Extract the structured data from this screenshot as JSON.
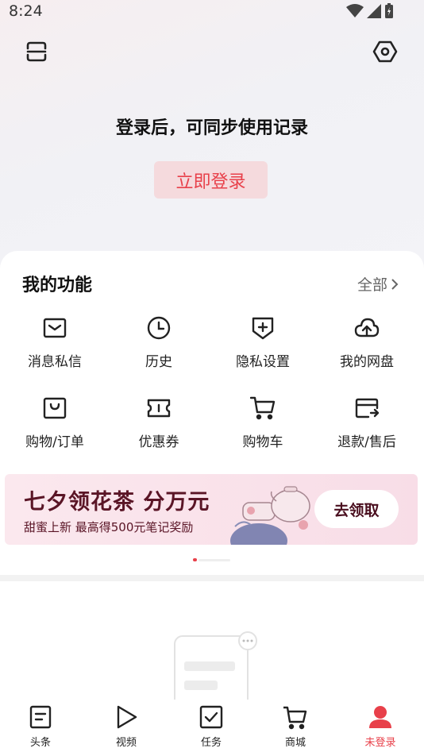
{
  "status_bar": {
    "time": "8:24"
  },
  "header": {
    "scan_icon": "scan-icon",
    "settings_icon": "hexagon-settings-icon"
  },
  "login": {
    "hint": "登录后，可同步使用记录",
    "button_label": "立即登录"
  },
  "functions": {
    "title": "我的功能",
    "see_all": "全部",
    "items": [
      {
        "label": "消息私信",
        "icon": "message-icon"
      },
      {
        "label": "历史",
        "icon": "clock-icon"
      },
      {
        "label": "隐私设置",
        "icon": "shield-plus-icon"
      },
      {
        "label": "我的网盘",
        "icon": "cloud-upload-icon"
      },
      {
        "label": "购物/订单",
        "icon": "shopping-bag-icon"
      },
      {
        "label": "优惠券",
        "icon": "coupon-icon"
      },
      {
        "label": "购物车",
        "icon": "cart-icon"
      },
      {
        "label": "退款/售后",
        "icon": "refund-card-icon"
      }
    ]
  },
  "banner": {
    "title": "七夕领花茶 分万元",
    "subtitle": "甜蜜上新  最高得500元笔记奖励",
    "cta": "去领取"
  },
  "carousel": {
    "active_index": 0
  },
  "tabs": [
    {
      "label": "头条",
      "icon": "document-icon",
      "active": false
    },
    {
      "label": "视频",
      "icon": "play-icon",
      "active": false
    },
    {
      "label": "任务",
      "icon": "checkbox-icon",
      "active": false
    },
    {
      "label": "商城",
      "icon": "cart-icon",
      "active": false
    },
    {
      "label": "未登录",
      "icon": "user-icon",
      "active": true
    }
  ],
  "colors": {
    "accent": "#e8404a",
    "login_button_bg": "#f5dadd",
    "banner_text": "#5a1526"
  }
}
